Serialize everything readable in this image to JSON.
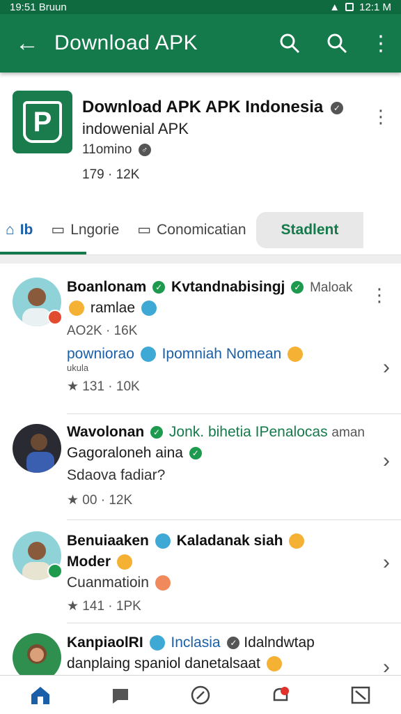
{
  "status": {
    "time": "19:51 Bruun",
    "right": "12:1 M"
  },
  "appbar": {
    "title": "Download APK"
  },
  "header": {
    "title": "Download APK APK Indonesia",
    "subtitle": "indowenial APK",
    "meta": "11omino",
    "count": "179 · 12K"
  },
  "tabs": [
    {
      "label": "Ib"
    },
    {
      "label": "Lngorie"
    },
    {
      "label": "Conomicatian"
    },
    {
      "label": "Stadlent"
    }
  ],
  "posts": [
    {
      "name": "Boanlonam",
      "name2": "Kvtandnabisingj",
      "tag": "Maloak",
      "line2": "ramlae",
      "stat": "AO2K · 16K",
      "link": "powniorao",
      "link2": "Ipomniah Nomean",
      "small": "ukula",
      "count": "★ 131 · 10K"
    },
    {
      "name": "Wavolonan",
      "name2": "Jonk. bihetia IPenalocas",
      "tag": "aman",
      "line2": "Gagoraloneh aina",
      "line3": "Sdaova fadiar?",
      "count": "★ 00 · 12K"
    },
    {
      "name": "Benuiaaken",
      "name2": "Kaladanak siah",
      "line2": "Moder",
      "line3": "Cuanmatioin",
      "count": "★ 141 · 1PK"
    },
    {
      "name": "KanpiaolRI",
      "name2": "Inclasia",
      "tag": "Idalndwtap",
      "line2": "danplaing spaniol danetalsaat"
    }
  ],
  "colors": {
    "primary": "#147a4b",
    "link": "#1a5fa8",
    "verified": "#1d9a4e"
  }
}
